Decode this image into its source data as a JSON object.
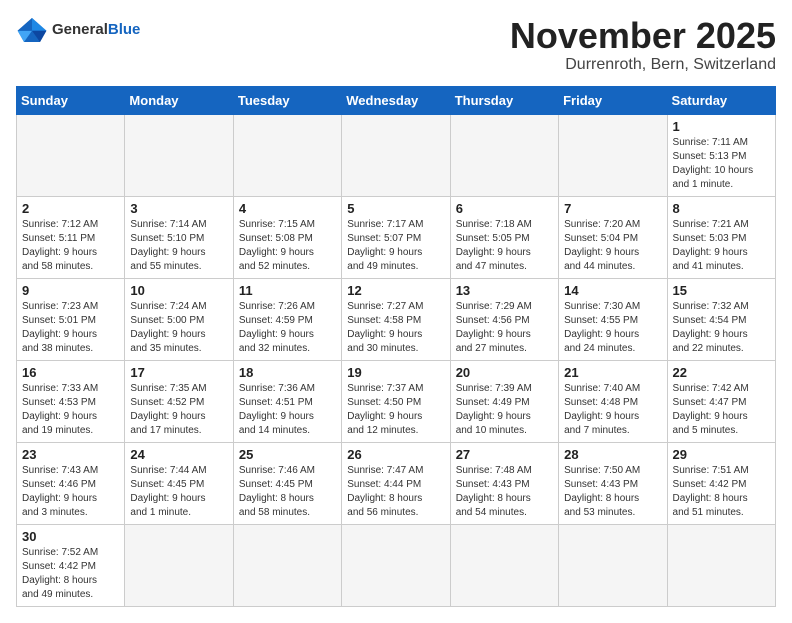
{
  "header": {
    "logo_general": "General",
    "logo_blue": "Blue",
    "month": "November 2025",
    "location": "Durrenroth, Bern, Switzerland"
  },
  "weekdays": [
    "Sunday",
    "Monday",
    "Tuesday",
    "Wednesday",
    "Thursday",
    "Friday",
    "Saturday"
  ],
  "days": [
    {
      "date": 1,
      "col": 6,
      "sunrise": "7:11 AM",
      "sunset": "5:13 PM",
      "daylight": "10 hours and 1 minute."
    },
    {
      "date": 2,
      "col": 0,
      "sunrise": "7:12 AM",
      "sunset": "5:11 PM",
      "daylight": "9 hours and 58 minutes."
    },
    {
      "date": 3,
      "col": 1,
      "sunrise": "7:14 AM",
      "sunset": "5:10 PM",
      "daylight": "9 hours and 55 minutes."
    },
    {
      "date": 4,
      "col": 2,
      "sunrise": "7:15 AM",
      "sunset": "5:08 PM",
      "daylight": "9 hours and 52 minutes."
    },
    {
      "date": 5,
      "col": 3,
      "sunrise": "7:17 AM",
      "sunset": "5:07 PM",
      "daylight": "9 hours and 49 minutes."
    },
    {
      "date": 6,
      "col": 4,
      "sunrise": "7:18 AM",
      "sunset": "5:05 PM",
      "daylight": "9 hours and 47 minutes."
    },
    {
      "date": 7,
      "col": 5,
      "sunrise": "7:20 AM",
      "sunset": "5:04 PM",
      "daylight": "9 hours and 44 minutes."
    },
    {
      "date": 8,
      "col": 6,
      "sunrise": "7:21 AM",
      "sunset": "5:03 PM",
      "daylight": "9 hours and 41 minutes."
    },
    {
      "date": 9,
      "col": 0,
      "sunrise": "7:23 AM",
      "sunset": "5:01 PM",
      "daylight": "9 hours and 38 minutes."
    },
    {
      "date": 10,
      "col": 1,
      "sunrise": "7:24 AM",
      "sunset": "5:00 PM",
      "daylight": "9 hours and 35 minutes."
    },
    {
      "date": 11,
      "col": 2,
      "sunrise": "7:26 AM",
      "sunset": "4:59 PM",
      "daylight": "9 hours and 32 minutes."
    },
    {
      "date": 12,
      "col": 3,
      "sunrise": "7:27 AM",
      "sunset": "4:58 PM",
      "daylight": "9 hours and 30 minutes."
    },
    {
      "date": 13,
      "col": 4,
      "sunrise": "7:29 AM",
      "sunset": "4:56 PM",
      "daylight": "9 hours and 27 minutes."
    },
    {
      "date": 14,
      "col": 5,
      "sunrise": "7:30 AM",
      "sunset": "4:55 PM",
      "daylight": "9 hours and 24 minutes."
    },
    {
      "date": 15,
      "col": 6,
      "sunrise": "7:32 AM",
      "sunset": "4:54 PM",
      "daylight": "9 hours and 22 minutes."
    },
    {
      "date": 16,
      "col": 0,
      "sunrise": "7:33 AM",
      "sunset": "4:53 PM",
      "daylight": "9 hours and 19 minutes."
    },
    {
      "date": 17,
      "col": 1,
      "sunrise": "7:35 AM",
      "sunset": "4:52 PM",
      "daylight": "9 hours and 17 minutes."
    },
    {
      "date": 18,
      "col": 2,
      "sunrise": "7:36 AM",
      "sunset": "4:51 PM",
      "daylight": "9 hours and 14 minutes."
    },
    {
      "date": 19,
      "col": 3,
      "sunrise": "7:37 AM",
      "sunset": "4:50 PM",
      "daylight": "9 hours and 12 minutes."
    },
    {
      "date": 20,
      "col": 4,
      "sunrise": "7:39 AM",
      "sunset": "4:49 PM",
      "daylight": "9 hours and 10 minutes."
    },
    {
      "date": 21,
      "col": 5,
      "sunrise": "7:40 AM",
      "sunset": "4:48 PM",
      "daylight": "9 hours and 7 minutes."
    },
    {
      "date": 22,
      "col": 6,
      "sunrise": "7:42 AM",
      "sunset": "4:47 PM",
      "daylight": "9 hours and 5 minutes."
    },
    {
      "date": 23,
      "col": 0,
      "sunrise": "7:43 AM",
      "sunset": "4:46 PM",
      "daylight": "9 hours and 3 minutes."
    },
    {
      "date": 24,
      "col": 1,
      "sunrise": "7:44 AM",
      "sunset": "4:45 PM",
      "daylight": "9 hours and 1 minute."
    },
    {
      "date": 25,
      "col": 2,
      "sunrise": "7:46 AM",
      "sunset": "4:45 PM",
      "daylight": "8 hours and 58 minutes."
    },
    {
      "date": 26,
      "col": 3,
      "sunrise": "7:47 AM",
      "sunset": "4:44 PM",
      "daylight": "8 hours and 56 minutes."
    },
    {
      "date": 27,
      "col": 4,
      "sunrise": "7:48 AM",
      "sunset": "4:43 PM",
      "daylight": "8 hours and 54 minutes."
    },
    {
      "date": 28,
      "col": 5,
      "sunrise": "7:50 AM",
      "sunset": "4:43 PM",
      "daylight": "8 hours and 53 minutes."
    },
    {
      "date": 29,
      "col": 6,
      "sunrise": "7:51 AM",
      "sunset": "4:42 PM",
      "daylight": "8 hours and 51 minutes."
    },
    {
      "date": 30,
      "col": 0,
      "sunrise": "7:52 AM",
      "sunset": "4:42 PM",
      "daylight": "8 hours and 49 minutes."
    }
  ],
  "labels": {
    "sunrise": "Sunrise:",
    "sunset": "Sunset:",
    "daylight": "Daylight:"
  }
}
